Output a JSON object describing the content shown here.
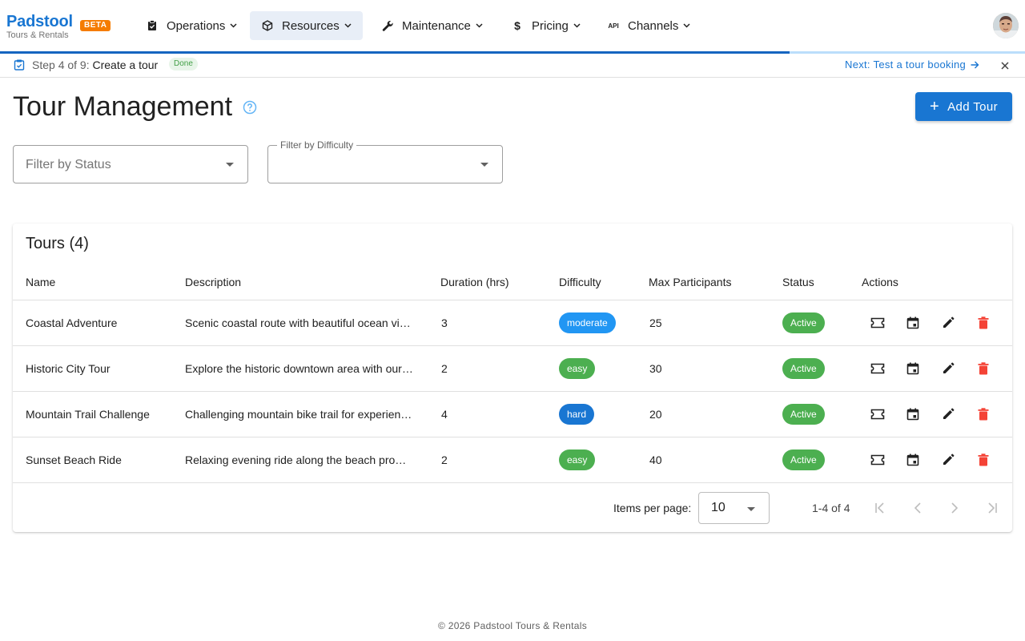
{
  "brand": {
    "name": "Padstool",
    "subtitle": "Tours & Rentals",
    "badge": "BETA"
  },
  "nav": {
    "items": [
      {
        "label": "Operations",
        "icon": "clipboard-icon"
      },
      {
        "label": "Resources",
        "icon": "cube-icon",
        "active": true
      },
      {
        "label": "Maintenance",
        "icon": "wrench-icon"
      },
      {
        "label": "Pricing",
        "icon": "dollar-icon"
      },
      {
        "label": "Channels",
        "icon": "api-icon",
        "icon_text": "API"
      }
    ]
  },
  "progress": {
    "fraction": 0.77
  },
  "step": {
    "prefix": "Step 4 of 9:",
    "name": "Create a tour",
    "status": "Done",
    "next_label": "Next: Test a tour booking"
  },
  "page": {
    "title": "Tour Management",
    "add_label": "Add Tour"
  },
  "filters": {
    "status_placeholder": "Filter by Status",
    "difficulty_label": "Filter by Difficulty"
  },
  "table": {
    "title": "Tours (4)",
    "columns": [
      "Name",
      "Description",
      "Duration (hrs)",
      "Difficulty",
      "Max Participants",
      "Status",
      "Actions"
    ],
    "rows": [
      {
        "name": "Coastal Adventure",
        "description": "Scenic coastal route with beautiful ocean views and stops",
        "duration": "3",
        "difficulty": "moderate",
        "max": "25",
        "status": "Active"
      },
      {
        "name": "Historic City Tour",
        "description": "Explore the historic downtown area with our expert guides",
        "duration": "2",
        "difficulty": "easy",
        "max": "30",
        "status": "Active"
      },
      {
        "name": "Mountain Trail Challenge",
        "description": "Challenging mountain bike trail for experienced riders",
        "duration": "4",
        "difficulty": "hard",
        "max": "20",
        "status": "Active"
      },
      {
        "name": "Sunset Beach Ride",
        "description": "Relaxing evening ride along the beach promenade",
        "duration": "2",
        "difficulty": "easy",
        "max": "40",
        "status": "Active"
      }
    ],
    "action_icons": [
      "ticket-icon",
      "calendar-icon",
      "edit-icon",
      "delete-icon"
    ]
  },
  "pagination": {
    "label": "Items per page:",
    "per_page": "10",
    "range": "1-4 of 4"
  },
  "colors": {
    "primary": "#1976d2",
    "moderate": "#2196f3",
    "easy": "#4caf50",
    "hard": "#1976d2",
    "active": "#4caf50",
    "delete": "#f44336",
    "beta": "#f57c00"
  },
  "footer": {
    "text": "© 2026 Padstool Tours & Rentals"
  }
}
